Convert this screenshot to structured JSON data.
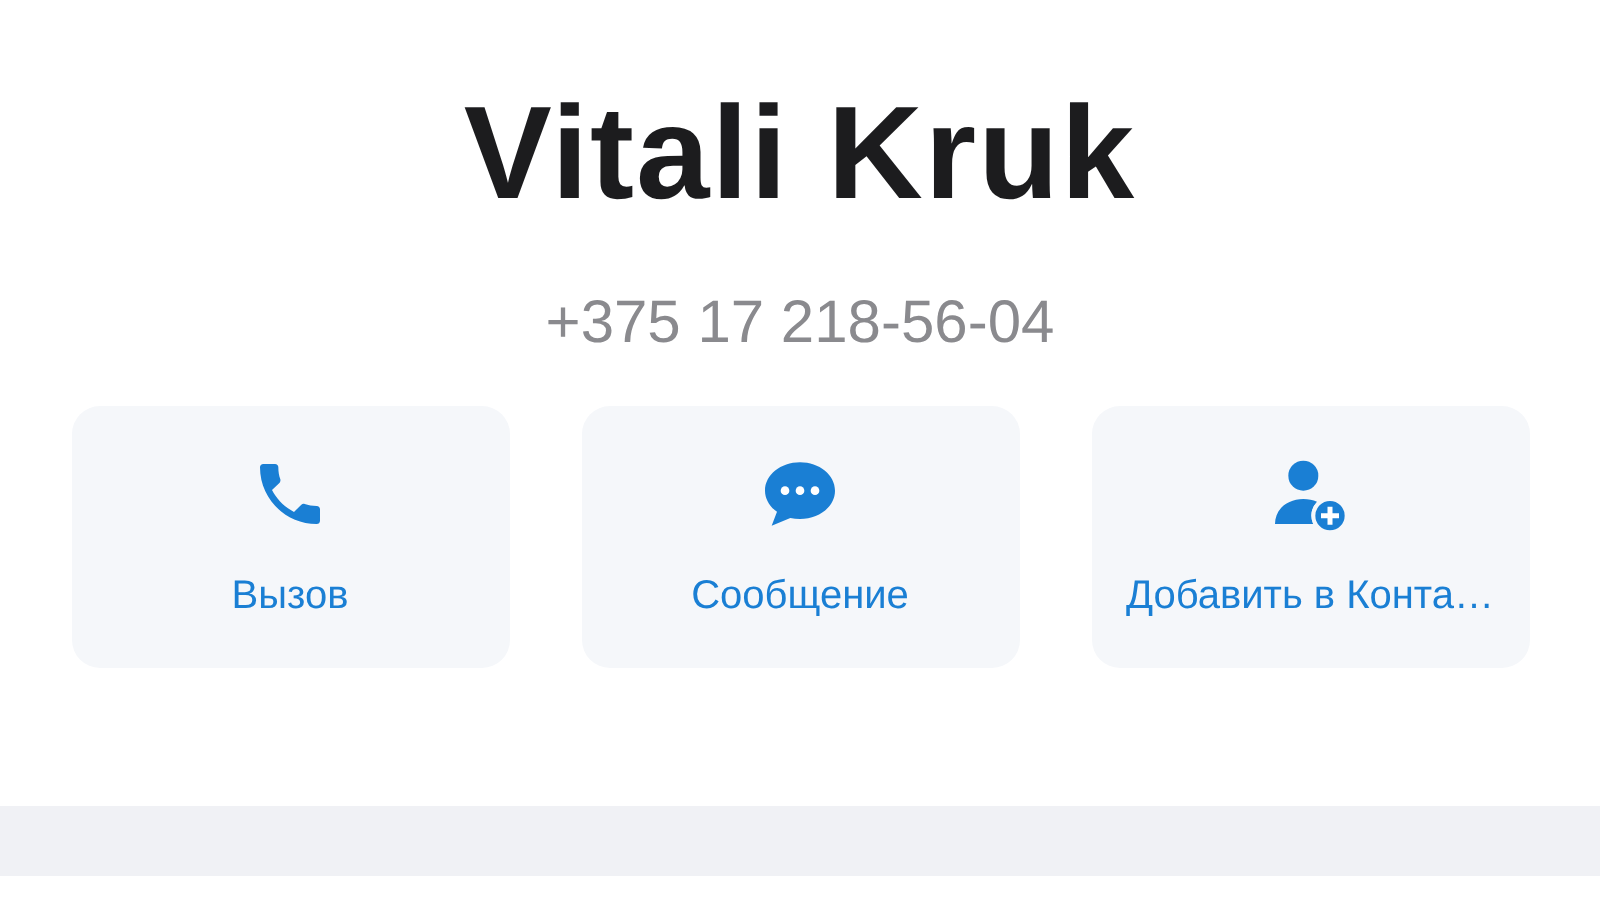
{
  "contact": {
    "name": "Vitali Kruk",
    "phone": "+375 17 218-56-04"
  },
  "actions": [
    {
      "kind": "call",
      "label": "Вызов"
    },
    {
      "kind": "message",
      "label": "Сообщение"
    },
    {
      "kind": "add-contact",
      "label": "Добавить в Конта…"
    }
  ]
}
